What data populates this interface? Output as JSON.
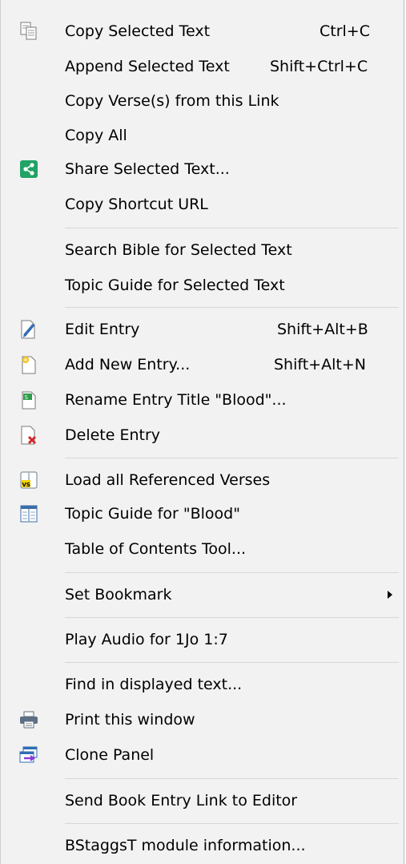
{
  "menu": {
    "copy_selected": {
      "label": "Copy Selected Text",
      "shortcut": "Ctrl+C",
      "icon": "copy-icon"
    },
    "append_selected": {
      "label": "Append Selected Text",
      "shortcut": "Shift+Ctrl+C"
    },
    "copy_verses": {
      "label": "Copy Verse(s) from this Link"
    },
    "copy_all": {
      "label": "Copy All"
    },
    "share_selected": {
      "label": "Share Selected Text...",
      "icon": "share-icon",
      "color": "#21a366"
    },
    "copy_shortcut": {
      "label": "Copy Shortcut URL"
    },
    "search_bible": {
      "label": "Search Bible for Selected Text"
    },
    "topic_guide_selected": {
      "label": "Topic Guide for Selected Text"
    },
    "edit_entry": {
      "label": "Edit Entry",
      "shortcut": "Shift+Alt+B",
      "icon": "edit-icon"
    },
    "add_entry": {
      "label": "Add New Entry...",
      "shortcut": "Shift+Alt+N",
      "icon": "new-document-icon"
    },
    "rename_entry": {
      "label": "Rename Entry Title \"Blood\"...",
      "icon": "rename-icon"
    },
    "delete_entry": {
      "label": "Delete Entry",
      "icon": "delete-document-icon"
    },
    "load_verses": {
      "label": "Load all Referenced Verses",
      "icon": "verses-icon"
    },
    "topic_guide_blood": {
      "label": "Topic Guide for \"Blood\"",
      "icon": "topic-guide-icon"
    },
    "toc_tool": {
      "label": "Table of Contents Tool..."
    },
    "set_bookmark": {
      "label": "Set Bookmark"
    },
    "play_audio": {
      "label": "Play Audio for 1Jo 1:7"
    },
    "find_text": {
      "label": "Find in displayed text..."
    },
    "print_window": {
      "label": "Print this window",
      "icon": "printer-icon"
    },
    "clone_panel": {
      "label": "Clone Panel",
      "icon": "clone-icon"
    },
    "send_link": {
      "label": "Send Book Entry Link to Editor"
    },
    "module_info": {
      "label": "BStaggsT module information..."
    }
  }
}
